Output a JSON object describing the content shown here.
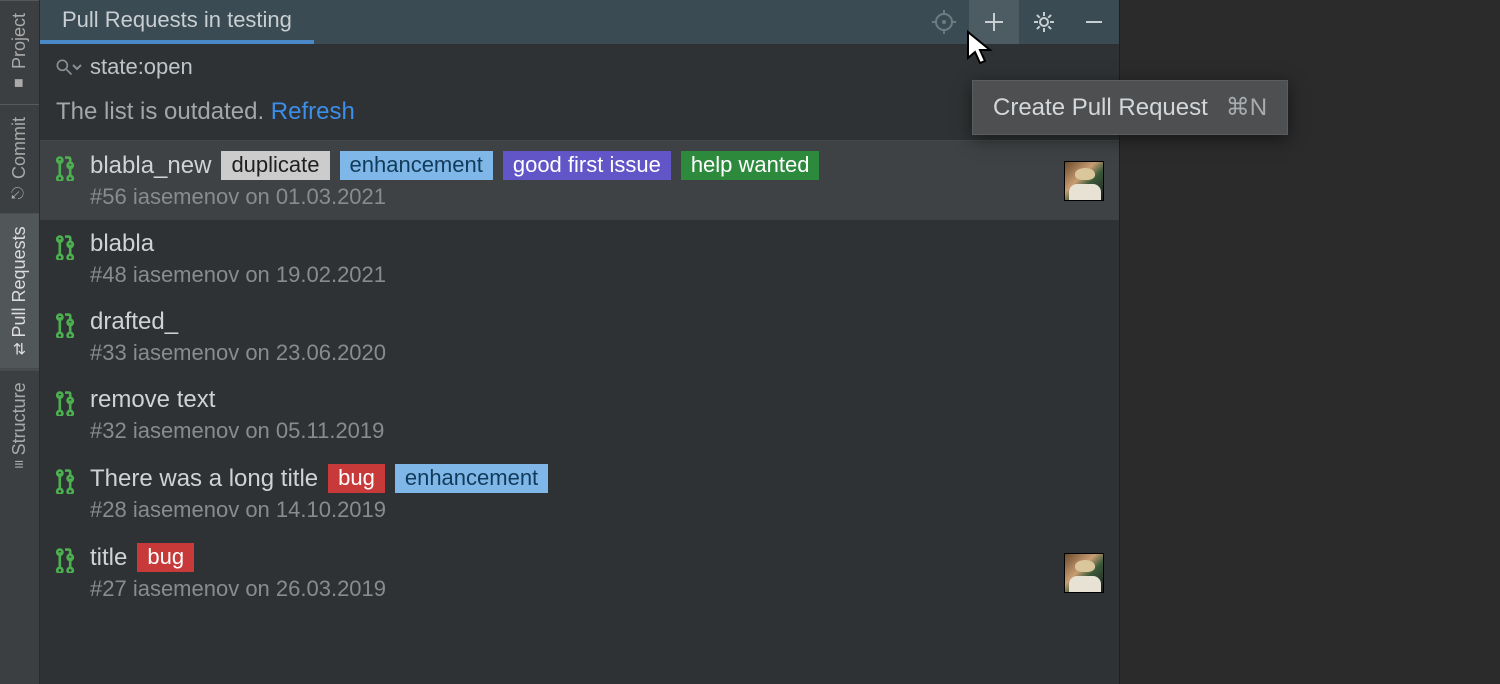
{
  "side": {
    "items": [
      {
        "label": "Project",
        "icon": "folder"
      },
      {
        "label": "Commit",
        "icon": "commit"
      },
      {
        "label": "Pull Requests",
        "icon": "pr",
        "active": true
      },
      {
        "label": "Structure",
        "icon": "structure"
      }
    ]
  },
  "header": {
    "tab_title": "Pull Requests in testing",
    "icons": {
      "locate": "locate-icon",
      "add": "plus-icon",
      "settings": "gear-icon",
      "minimize": "minimize-icon"
    }
  },
  "search": {
    "value": "state:open"
  },
  "notice": {
    "text": "The list is outdated. ",
    "link": "Refresh"
  },
  "tooltip": {
    "text": "Create Pull Request",
    "shortcut": "⌘N"
  },
  "label_styles": {
    "duplicate": {
      "bg": "#cccccc",
      "fg": "#1f1f1f"
    },
    "enhancement": {
      "bg": "#7fb8e8",
      "fg": "#133a5a"
    },
    "good first issue": {
      "bg": "#6155c8",
      "fg": "#ffffff"
    },
    "help wanted": {
      "bg": "#2d8a3d",
      "fg": "#ffffff"
    },
    "bug": {
      "bg": "#c83a3a",
      "fg": "#ffffff"
    }
  },
  "pull_requests": [
    {
      "title": "blabla_new",
      "number": "#56",
      "author": "iasemenov",
      "date": "01.03.2021",
      "labels": [
        "duplicate",
        "enhancement",
        "good first issue",
        "help wanted"
      ],
      "selected": true,
      "has_avatar": true
    },
    {
      "title": "blabla",
      "number": "#48",
      "author": "iasemenov",
      "date": "19.02.2021",
      "labels": [],
      "selected": false,
      "has_avatar": false
    },
    {
      "title": "drafted_",
      "number": "#33",
      "author": "iasemenov",
      "date": "23.06.2020",
      "labels": [],
      "selected": false,
      "has_avatar": false
    },
    {
      "title": "remove  text",
      "number": "#32",
      "author": "iasemenov",
      "date": "05.11.2019",
      "labels": [],
      "selected": false,
      "has_avatar": false
    },
    {
      "title": "There was a long title",
      "number": "#28",
      "author": "iasemenov",
      "date": "14.10.2019",
      "labels": [
        "bug",
        "enhancement"
      ],
      "selected": false,
      "has_avatar": false
    },
    {
      "title": "title",
      "number": "#27",
      "author": "iasemenov",
      "date": "26.03.2019",
      "labels": [
        "bug"
      ],
      "selected": false,
      "has_avatar": true
    }
  ]
}
